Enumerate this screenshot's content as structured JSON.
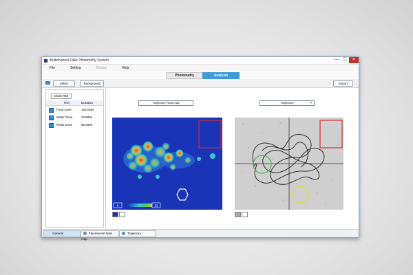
{
  "window": {
    "title": "Multichannel Fiber Photometry System",
    "controls": [
      "—",
      "☐",
      "✕"
    ]
  },
  "menu": {
    "items": [
      {
        "label": "File"
      },
      {
        "label": "Setting"
      },
      {
        "label": "Device",
        "disabled": true
      },
      {
        "label": "Help"
      }
    ]
  },
  "main_tabs": [
    {
      "label": "Photometry",
      "active": false
    },
    {
      "label": "Analysis",
      "active": true
    }
  ],
  "toolbar": {
    "select_label": "Select",
    "background_label": "Background",
    "export_label": "Export"
  },
  "roi_panel": {
    "close_roi_label": "Close ROI",
    "headers": {
      "roi": "ROI",
      "duration": "Duration"
    },
    "rows": [
      {
        "name": "Food Zone",
        "duration": "123.005s"
      },
      {
        "name": "Water Zone",
        "duration": "23.500s"
      },
      {
        "name": "Relax Zone",
        "duration": "56.000s"
      }
    ]
  },
  "views": {
    "heatmap_select": "Trajectory heat map",
    "trajectory_select": "Trajectory",
    "colorbar_min": "0",
    "colorbar_max": "22"
  },
  "bottom_tabs": [
    {
      "label": "General",
      "active": true
    },
    {
      "label": "Fluorescent heat map"
    },
    {
      "label": "Trajectory"
    }
  ],
  "colors": {
    "accent": "#3f9bd6",
    "heatmap_bg": "#1a34b8",
    "roi_red": "#d32f2f",
    "roi_green": "#4caf50",
    "roi_yellow": "#e5d63a"
  },
  "icons": {
    "folder": "folder-icon",
    "roi_row": "roi-color-icon",
    "pencil": "edit-icon"
  }
}
